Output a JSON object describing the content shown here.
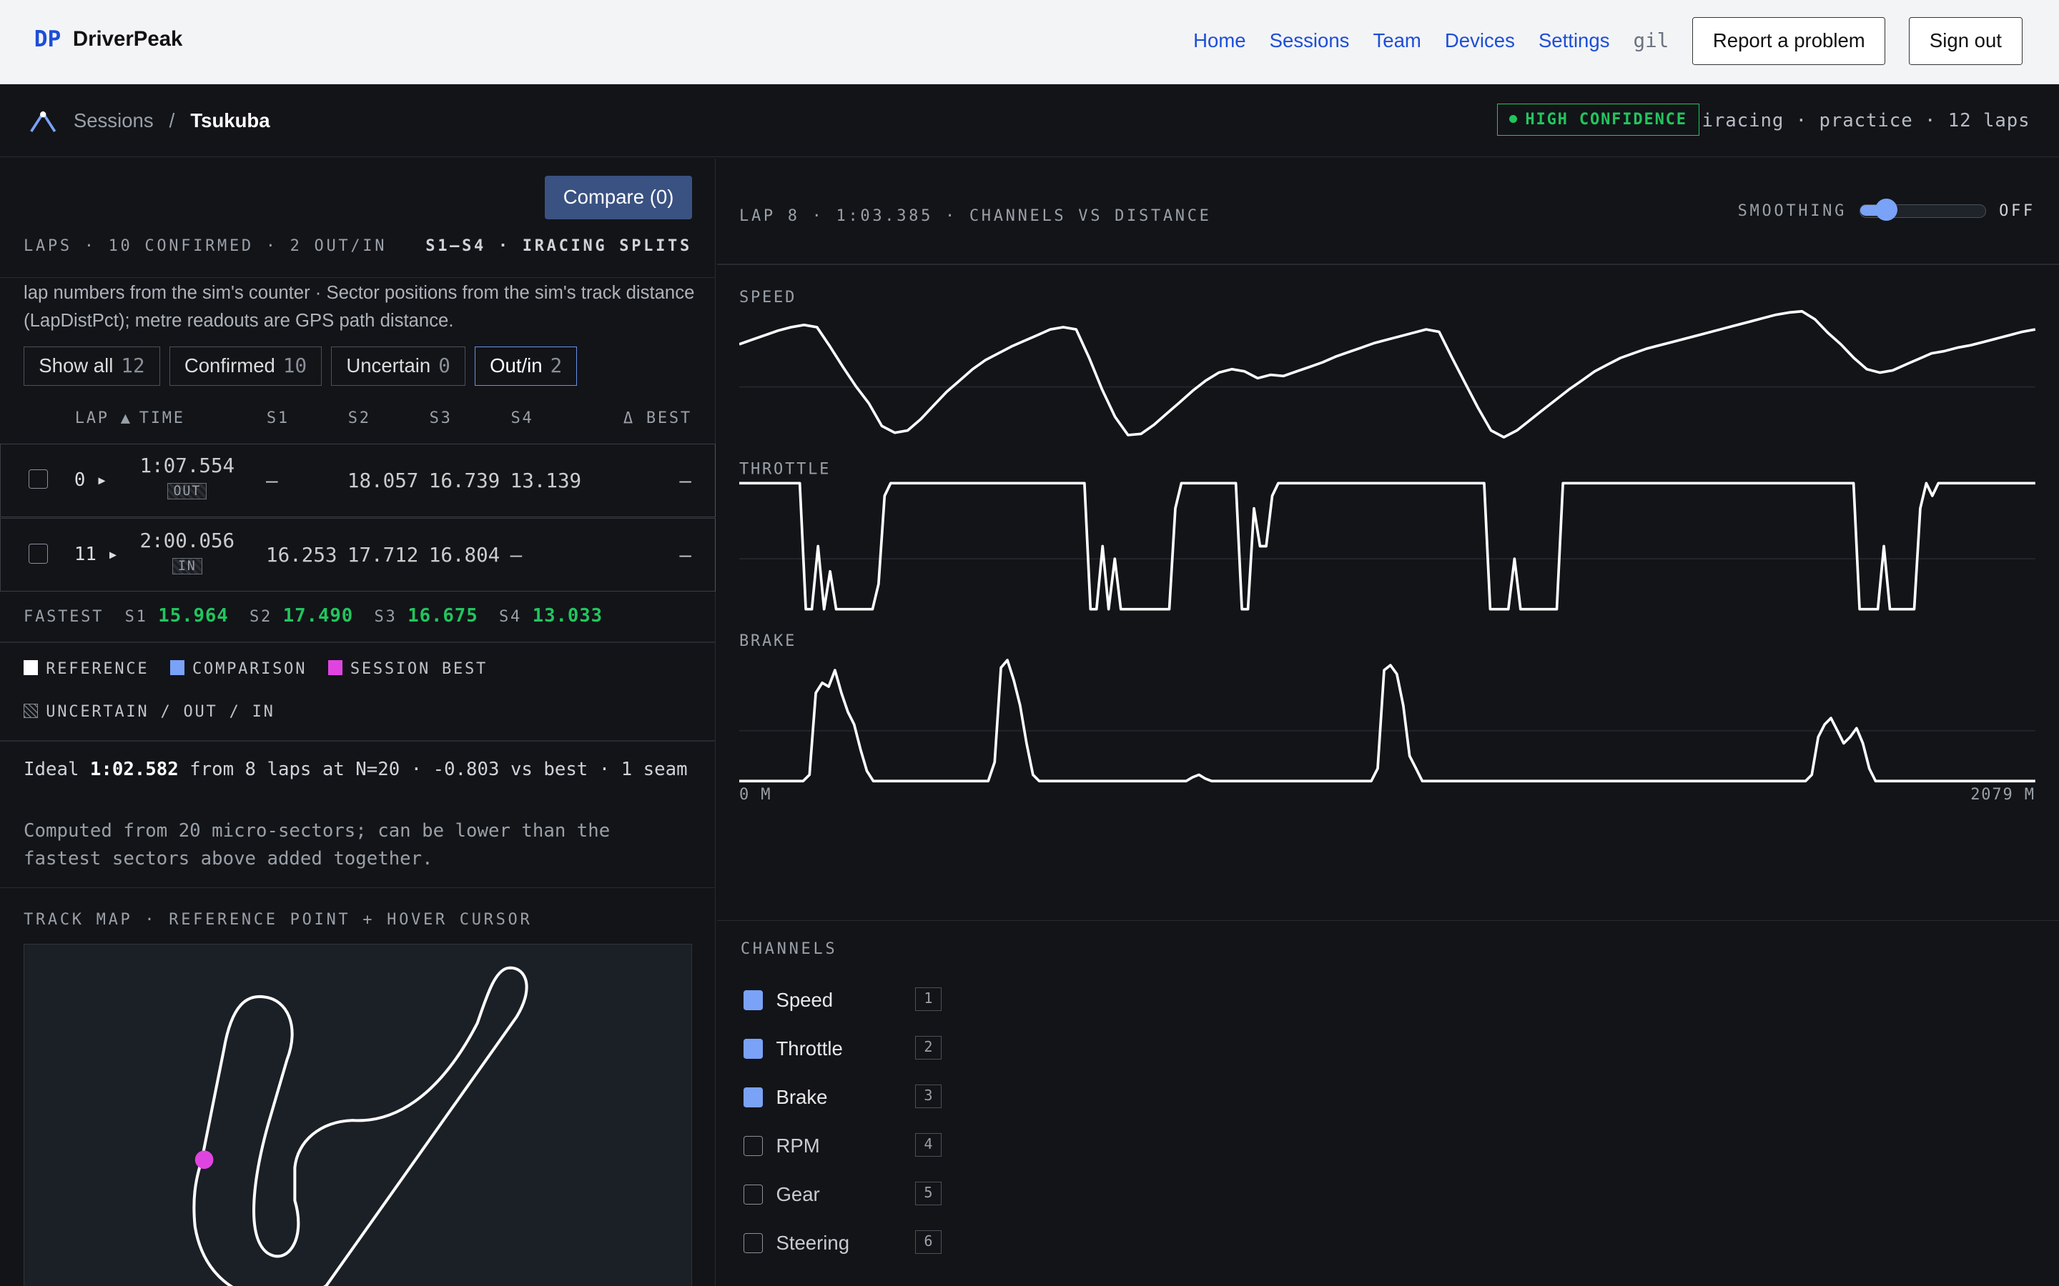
{
  "topbar": {
    "logo": "DP",
    "app_name": "DriverPeak",
    "nav": [
      "Home",
      "Sessions",
      "Team",
      "Devices",
      "Settings"
    ],
    "user": "gil",
    "report_label": "Report a problem",
    "signout_label": "Sign out"
  },
  "breadcrumb": {
    "root": "Sessions",
    "sep": "/",
    "current": "Tsukuba"
  },
  "session": {
    "confidence": "HIGH CONFIDENCE",
    "info": "iracing · practice · 12 laps"
  },
  "laps_panel": {
    "compare_label": "Compare (0)",
    "summary": "LAPS · 10 CONFIRMED · 2 OUT/IN",
    "splits_label": "S1–S4 · IRACING SPLITS",
    "description": "lap numbers from the sim's counter · Sector positions from the sim's track distance (LapDistPct); metre readouts are GPS path distance.",
    "filters": [
      {
        "label": "Show all",
        "count": "12"
      },
      {
        "label": "Confirmed",
        "count": "10"
      },
      {
        "label": "Uncertain",
        "count": "0"
      },
      {
        "label": "Out/in",
        "count": "2"
      }
    ],
    "columns": {
      "lap": "LAP ▲",
      "time": "TIME",
      "s1": "S1",
      "s2": "S2",
      "s3": "S3",
      "s4": "S4",
      "delta": "Δ BEST"
    },
    "rows": [
      {
        "lap": "0 ▸",
        "time": "1:07.554",
        "tag": "OUT",
        "s1": "—",
        "s2": "18.057",
        "s3": "16.739",
        "s4": "13.139",
        "delta": "—"
      },
      {
        "lap": "11 ▸",
        "time": "2:00.056",
        "tag": "IN",
        "s1": "16.253",
        "s2": "17.712",
        "s3": "16.804",
        "s4": "—",
        "delta": "—"
      }
    ],
    "fastest": {
      "label": "FASTEST",
      "s1": "15.964",
      "s2": "17.490",
      "s3": "16.675",
      "s4": "13.033",
      "s1_label": "S1",
      "s2_label": "S2",
      "s3_label": "S3",
      "s4_label": "S4"
    },
    "legend": {
      "reference": "REFERENCE",
      "comparison": "COMPARISON",
      "session_best": "SESSION BEST",
      "uncertain": "UNCERTAIN / OUT / IN"
    },
    "ideal": {
      "prefix": "Ideal",
      "time": "1:02.582",
      "suffix": "from 8 laps at N=20 · -0.803 vs best · 1 seam",
      "note": "Computed from 20 micro-sectors; can be lower than the fastest sectors above added together."
    },
    "map_label": "TRACK MAP · REFERENCE POINT + HOVER CURSOR"
  },
  "chart_panel": {
    "title": "LAP 8 · 1:03.385 · CHANNELS VS DISTANCE",
    "smoothing_label": "SMOOTHING",
    "smoothing_value": "OFF",
    "distance_start": "0 M",
    "distance_end": "2079 M"
  },
  "chart_data": {
    "type": "line",
    "x_range": [
      0,
      2079
    ],
    "charts": [
      {
        "label": "SPEED",
        "y_range": [
          0,
          1
        ],
        "series": [
          {
            "values": [
              0.82,
              0.86,
              0.9,
              0.94,
              0.97,
              0.99,
              0.97,
              0.8,
              0.62,
              0.45,
              0.3,
              0.1,
              0.04,
              0.06,
              0.16,
              0.28,
              0.4,
              0.5,
              0.6,
              0.68,
              0.74,
              0.8,
              0.85,
              0.9,
              0.95,
              0.97,
              0.95,
              0.7,
              0.42,
              0.18,
              0.02,
              0.03,
              0.11,
              0.21,
              0.31,
              0.41,
              0.5,
              0.57,
              0.6,
              0.58,
              0.52,
              0.55,
              0.54,
              0.58,
              0.62,
              0.66,
              0.71,
              0.75,
              0.79,
              0.83,
              0.86,
              0.89,
              0.92,
              0.95,
              0.93,
              0.7,
              0.48,
              0.26,
              0.06,
              0.0,
              0.06,
              0.15,
              0.24,
              0.33,
              0.42,
              0.5,
              0.58,
              0.64,
              0.7,
              0.74,
              0.78,
              0.81,
              0.84,
              0.87,
              0.9,
              0.93,
              0.96,
              0.99,
              1.02,
              1.05,
              1.08,
              1.1,
              1.11,
              1.04,
              0.92,
              0.82,
              0.7,
              0.6,
              0.57,
              0.59,
              0.64,
              0.69,
              0.74,
              0.76,
              0.79,
              0.81,
              0.84,
              0.87,
              0.9,
              0.93,
              0.95
            ]
          }
        ]
      },
      {
        "label": "THROTTLE",
        "y_range": [
          0,
          1
        ],
        "series": [
          {
            "values": [
              1,
              1,
              1,
              1,
              1,
              1,
              1,
              1,
              1,
              1,
              1,
              0,
              0,
              0.5,
              0,
              0.3,
              0,
              0,
              0,
              0,
              0,
              0,
              0,
              0.2,
              0.9,
              1,
              1,
              1,
              1,
              1,
              1,
              1,
              1,
              1,
              1,
              1,
              1,
              1,
              1,
              1,
              1,
              1,
              1,
              1,
              1,
              1,
              1,
              1,
              1,
              1,
              1,
              1,
              1,
              1,
              1,
              1,
              1,
              1,
              0,
              0,
              0.5,
              0,
              0.4,
              0,
              0,
              0,
              0,
              0,
              0,
              0,
              0,
              0,
              0.8,
              1,
              1,
              1,
              1,
              1,
              1,
              1,
              1,
              1,
              1,
              0,
              0,
              0.8,
              0.5,
              0.5,
              0.9,
              1,
              1,
              1,
              1,
              1,
              1,
              1,
              1,
              1,
              1,
              1,
              1,
              1,
              1,
              1,
              1,
              1,
              1,
              1,
              1,
              1,
              1,
              1,
              1,
              1,
              1,
              1,
              1,
              1,
              1,
              1,
              1,
              1,
              1,
              1,
              0,
              0,
              0,
              0,
              0.4,
              0,
              0,
              0,
              0,
              0,
              0,
              0,
              1,
              1,
              1,
              1,
              1,
              1,
              1,
              1,
              1,
              1,
              1,
              1,
              1,
              1,
              1,
              1,
              1,
              1,
              1,
              1,
              1,
              1,
              1,
              1,
              1,
              1,
              1,
              1,
              1,
              1,
              1,
              1,
              1,
              1,
              1,
              1,
              1,
              1,
              1,
              1,
              1,
              1,
              1,
              1,
              1,
              1,
              1,
              1,
              1,
              0,
              0,
              0,
              0,
              0.5,
              0,
              0,
              0,
              0,
              0,
              0.8,
              1,
              0.9,
              1,
              1,
              1,
              1,
              1,
              1,
              1,
              1,
              1,
              1,
              1,
              1,
              1,
              1,
              1,
              1,
              1
            ]
          }
        ]
      },
      {
        "label": "BRAKE",
        "y_range": [
          0,
          1
        ],
        "series": [
          {
            "values": [
              0,
              0,
              0,
              0,
              0,
              0,
              0,
              0,
              0,
              0,
              0,
              0.05,
              0.7,
              0.78,
              0.75,
              0.88,
              0.7,
              0.55,
              0.45,
              0.25,
              0.08,
              0,
              0,
              0,
              0,
              0,
              0,
              0,
              0,
              0,
              0,
              0,
              0,
              0,
              0,
              0,
              0,
              0,
              0,
              0,
              0.15,
              0.9,
              0.96,
              0.8,
              0.6,
              0.3,
              0.05,
              0,
              0,
              0,
              0,
              0,
              0,
              0,
              0,
              0,
              0,
              0,
              0,
              0,
              0,
              0,
              0,
              0,
              0,
              0,
              0,
              0,
              0,
              0,
              0,
              0.03,
              0.05,
              0.02,
              0,
              0,
              0,
              0,
              0,
              0,
              0,
              0,
              0,
              0,
              0,
              0,
              0,
              0,
              0,
              0,
              0,
              0,
              0,
              0,
              0,
              0,
              0,
              0,
              0,
              0,
              0.1,
              0.88,
              0.92,
              0.85,
              0.6,
              0.2,
              0.1,
              0,
              0,
              0,
              0,
              0,
              0,
              0,
              0,
              0,
              0,
              0,
              0,
              0,
              0,
              0,
              0,
              0,
              0,
              0,
              0,
              0,
              0,
              0,
              0,
              0,
              0,
              0,
              0,
              0,
              0,
              0,
              0,
              0,
              0,
              0,
              0,
              0,
              0,
              0,
              0,
              0,
              0,
              0,
              0,
              0,
              0,
              0,
              0,
              0,
              0,
              0,
              0,
              0,
              0,
              0,
              0,
              0,
              0,
              0,
              0,
              0,
              0.05,
              0.35,
              0.45,
              0.5,
              0.4,
              0.3,
              0.35,
              0.42,
              0.3,
              0.1,
              0,
              0,
              0,
              0,
              0,
              0,
              0,
              0,
              0,
              0,
              0,
              0,
              0,
              0,
              0,
              0,
              0,
              0,
              0,
              0,
              0,
              0,
              0,
              0,
              0,
              0
            ]
          }
        ]
      }
    ]
  },
  "channels": {
    "label": "CHANNELS",
    "items": [
      {
        "name": "Speed",
        "key": "1",
        "on": true
      },
      {
        "name": "Throttle",
        "key": "2",
        "on": true
      },
      {
        "name": "Brake",
        "key": "3",
        "on": true
      },
      {
        "name": "RPM",
        "key": "4",
        "on": false
      },
      {
        "name": "Gear",
        "key": "5",
        "on": false
      },
      {
        "name": "Steering",
        "key": "6",
        "on": false
      }
    ]
  },
  "colors": {
    "accent": "#1d4ed8",
    "confidence": "#22c55e",
    "comparison": "#7aa2f7",
    "session_best": "#e044e0",
    "reference": "#ffffff"
  }
}
